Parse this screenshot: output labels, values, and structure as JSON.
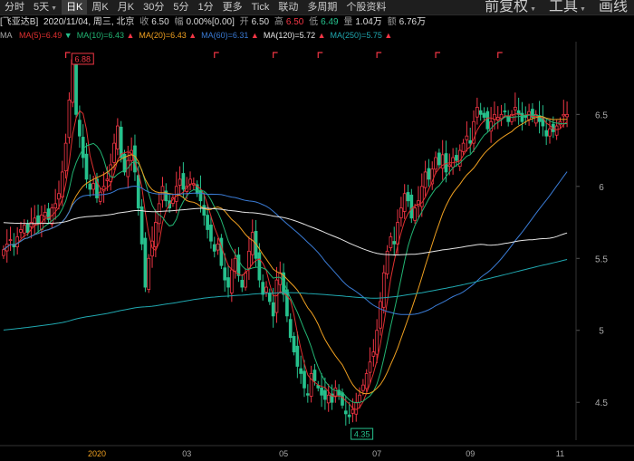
{
  "toolbar": {
    "tabs": [
      "分时",
      "5天",
      "日K",
      "周K",
      "月K",
      "30分",
      "5分",
      "1分",
      "更多",
      "Tick",
      "联动",
      "多周期",
      "个股资料"
    ],
    "active_tab": "日K",
    "right": [
      "前复权",
      "工具",
      "画线"
    ]
  },
  "info": {
    "stock": "[飞亚达B]",
    "date": "2020/11/04, 周三, 北京",
    "close_label": "收",
    "close": "6.50",
    "change_label": "幅",
    "change": "0.00%[0.00]",
    "open_label": "开",
    "open": "6.50",
    "high_label": "高",
    "high": "6.50",
    "low_label": "低",
    "low": "6.49",
    "volume_label": "量",
    "volume": "1.04万",
    "amount_label": "额",
    "amount": "6.76万"
  },
  "ma": {
    "label": "MA",
    "items": [
      {
        "text": "MA(5)=6.49",
        "color": "#e03030",
        "arrow": "down"
      },
      {
        "text": "MA(10)=6.43",
        "color": "#22b573",
        "arrow": "up"
      },
      {
        "text": "MA(20)=6.43",
        "color": "#f0a020",
        "arrow": "up"
      },
      {
        "text": "MA(60)=6.31",
        "color": "#3a7bd5",
        "arrow": "up"
      },
      {
        "text": "MA(120)=5.72",
        "color": "#e6e6e6",
        "arrow": "up"
      },
      {
        "text": "MA(250)=5.75",
        "color": "#20a8b0",
        "arrow": "up"
      }
    ]
  },
  "chart_data": {
    "type": "candlestick",
    "y_ticks": [
      "6.5",
      "6",
      "5.5",
      "5",
      "4.5"
    ],
    "y_tick_values": [
      6.5,
      6.0,
      5.5,
      5.0,
      4.5
    ],
    "ylim": [
      4.3,
      6.93
    ],
    "x_ticks": [
      "2020",
      "03",
      "05",
      "07",
      "09",
      "11"
    ],
    "x_tick_days": [
      27,
      53,
      81,
      108,
      135,
      161
    ],
    "days": 164,
    "max_label": "6.88",
    "min_label": "4.35",
    "up_color": "#f23645",
    "down_color": "#26c08c",
    "closes": [
      5.56,
      5.6,
      5.63,
      5.58,
      5.65,
      5.7,
      5.73,
      5.68,
      5.75,
      5.78,
      5.74,
      5.8,
      5.82,
      5.77,
      5.85,
      5.88,
      5.95,
      6.1,
      6.3,
      6.6,
      6.88,
      6.5,
      6.35,
      6.2,
      6.05,
      5.98,
      6.02,
      5.92,
      5.96,
      6.0,
      6.05,
      6.15,
      6.3,
      6.42,
      6.2,
      6.1,
      6.18,
      6.25,
      6.1,
      5.85,
      5.6,
      5.3,
      5.5,
      5.62,
      5.75,
      5.88,
      6.0,
      5.9,
      5.85,
      5.92,
      6.0,
      6.05,
      5.98,
      6.0,
      6.05,
      6.02,
      5.95,
      5.9,
      5.8,
      5.7,
      5.62,
      5.55,
      5.6,
      5.45,
      5.35,
      5.3,
      5.42,
      5.5,
      5.38,
      5.3,
      5.4,
      5.55,
      5.68,
      5.5,
      5.35,
      5.25,
      5.3,
      5.2,
      5.1,
      5.35,
      5.4,
      5.25,
      5.1,
      4.95,
      4.85,
      4.75,
      4.7,
      4.6,
      4.55,
      4.7,
      4.65,
      4.6,
      4.55,
      4.52,
      4.55,
      4.5,
      4.6,
      4.55,
      4.48,
      4.42,
      4.4,
      4.45,
      4.5,
      4.55,
      4.62,
      4.7,
      4.78,
      4.85,
      5.0,
      5.2,
      5.4,
      5.55,
      5.65,
      5.6,
      5.75,
      5.85,
      5.95,
      5.9,
      5.78,
      5.85,
      5.9,
      6.0,
      6.1,
      6.05,
      6.12,
      6.2,
      6.15,
      6.22,
      6.1,
      6.15,
      6.2,
      6.18,
      6.25,
      6.3,
      6.35,
      6.3,
      6.45,
      6.55,
      6.5,
      6.48,
      6.4,
      6.45,
      6.5,
      6.48,
      6.5,
      6.52,
      6.45,
      6.5,
      6.55,
      6.5,
      6.45,
      6.48,
      6.52,
      6.48,
      6.5,
      6.45,
      6.42,
      6.35,
      6.4,
      6.38,
      6.42,
      6.45,
      6.5,
      6.5
    ],
    "ma_lines": [
      {
        "name": "MA(5)",
        "period": 5,
        "color": "#e03030"
      },
      {
        "name": "MA(10)",
        "period": 10,
        "color": "#22b573"
      },
      {
        "name": "MA(20)",
        "period": 20,
        "color": "#f0a020"
      },
      {
        "name": "MA(60)",
        "period": 60,
        "color": "#3a7bd5"
      },
      {
        "name": "MA(120)",
        "period": 120,
        "color": "#e6e6e6",
        "first_value": 5.75
      },
      {
        "name": "MA(250)",
        "period": 250,
        "color": "#20a8b0",
        "first_value": 5.0
      }
    ],
    "top_markers_days": [
      18,
      61,
      78,
      91,
      108,
      125,
      143
    ]
  }
}
